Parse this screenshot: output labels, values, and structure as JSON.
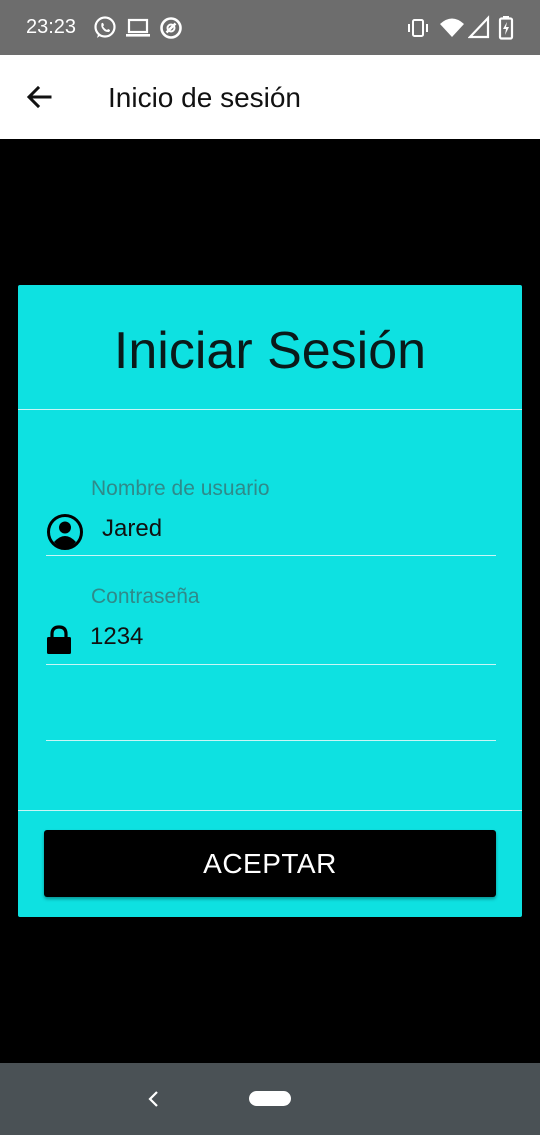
{
  "status_bar": {
    "time": "23:23",
    "left_icons": [
      "whatsapp-icon",
      "laptop-icon",
      "data-saver-icon"
    ],
    "right_icons": [
      "vibrate-icon",
      "wifi-icon",
      "signal-icon",
      "battery-charging-icon"
    ]
  },
  "app_bar": {
    "back_icon": "arrow-left-icon",
    "title": "Inicio de sesión"
  },
  "login_card": {
    "title": "Iniciar Sesión",
    "username": {
      "label": "Nombre de usuario",
      "value": "Jared",
      "icon": "account-circle-icon"
    },
    "password": {
      "label": "Contraseña",
      "value": "1234",
      "icon": "lock-icon"
    },
    "submit_label": "ACEPTAR"
  },
  "colors": {
    "card_background": "#0ee1e1",
    "button_background": "#000000",
    "status_bar": "#6d6d6d",
    "nav_bar": "#4a5155"
  },
  "nav_bar": {
    "back_icon": "nav-back-icon",
    "home_icon": "nav-home-pill"
  }
}
